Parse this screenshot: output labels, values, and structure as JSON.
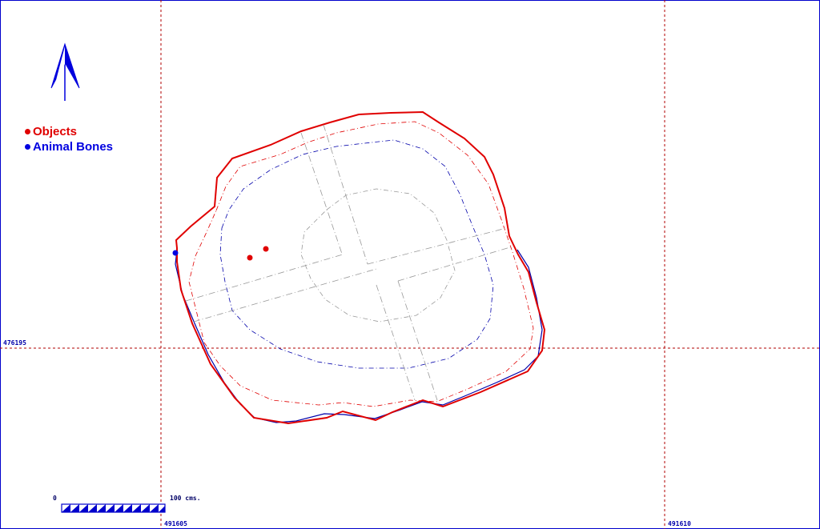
{
  "legend": {
    "objects": {
      "label": "Objects",
      "color": "#e00000"
    },
    "animal_bones": {
      "label": "Animal Bones",
      "color": "#0000e0"
    }
  },
  "grid": {
    "easting_left": "491605",
    "easting_right": "491610",
    "northing": "476195",
    "line_color": "#b00000"
  },
  "scale_bar": {
    "start_label": "0",
    "end_label": "100 cms.",
    "color": "#0000cc"
  },
  "north_arrow": {
    "icon": "north-arrow-icon",
    "color": "#0000dd"
  },
  "finds": {
    "objects_count": 2,
    "animal_bones_count": 1
  },
  "colors": {
    "cut_outline": "#e00000",
    "base_outline": "#0000aa",
    "section_lines": "#999999"
  }
}
